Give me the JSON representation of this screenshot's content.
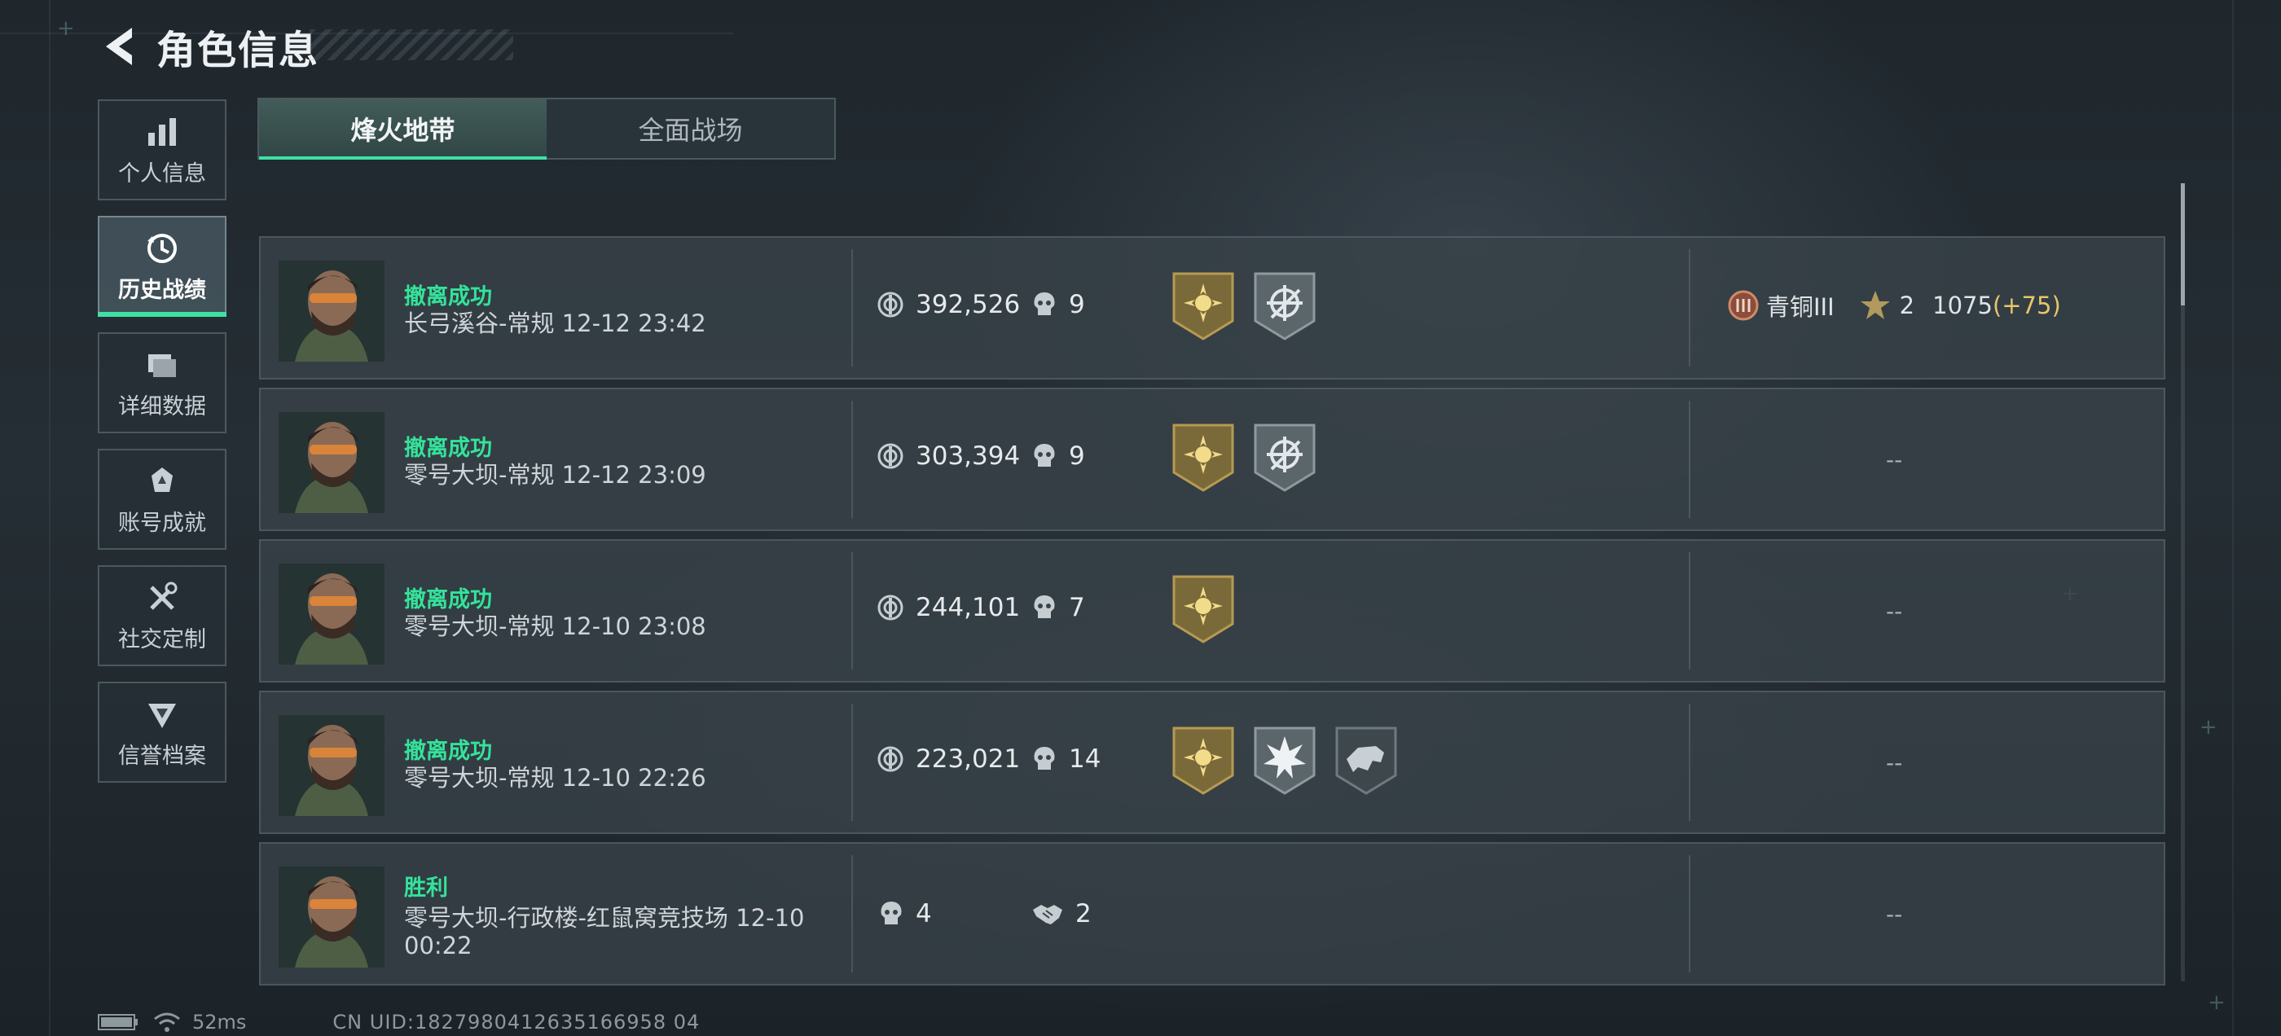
{
  "header": {
    "title": "角色信息",
    "back_icon": "chevron-left-icon"
  },
  "sidenav": {
    "items": [
      {
        "label": "个人信息",
        "icon": "bar-chart-icon",
        "active": false
      },
      {
        "label": "历史战绩",
        "icon": "history-clock-icon",
        "active": true
      },
      {
        "label": "详细数据",
        "icon": "folders-icon",
        "active": false
      },
      {
        "label": "账号成就",
        "icon": "achievement-icon",
        "active": false
      },
      {
        "label": "社交定制",
        "icon": "tools-icon",
        "active": false
      },
      {
        "label": "信誉档案",
        "icon": "reputation-shield-icon",
        "active": false
      }
    ]
  },
  "tabs": [
    {
      "label": "烽火地带",
      "active": true
    },
    {
      "label": "全面战场",
      "active": false
    }
  ],
  "matches": [
    {
      "result": "撤离成功",
      "map": "长弓溪谷-常规 12-12 23:42",
      "value": "392,526",
      "kills": "9",
      "badges": [
        "gold-sun-badge",
        "silver-crosshair-badge"
      ],
      "rank": {
        "name": "青铜III",
        "stars": "2",
        "score": "1075",
        "gain": "(+75)"
      }
    },
    {
      "result": "撤离成功",
      "map": "零号大坝-常规 12-12 23:09",
      "value": "303,394",
      "kills": "9",
      "badges": [
        "gold-sun-badge",
        "silver-crosshair-badge"
      ],
      "right": "--"
    },
    {
      "result": "撤离成功",
      "map": "零号大坝-常规 12-10 23:08",
      "value": "244,101",
      "kills": "7",
      "badges": [
        "gold-sun-badge"
      ],
      "right": "--"
    },
    {
      "result": "撤离成功",
      "map": "零号大坝-常规 12-10 22:26",
      "value": "223,021",
      "kills": "14",
      "badges": [
        "gold-sun-badge",
        "silver-burst-badge",
        "dark-bull-badge"
      ],
      "right": "--"
    },
    {
      "result": "胜利",
      "map": "零号大坝-行政楼-红鼠窝竞技场 12-10 00:22",
      "kills": "4",
      "assists": "2",
      "right": "--"
    }
  ],
  "footer": {
    "ping": "52ms",
    "uid": "CN UID:1827980412635166958 04"
  },
  "colors": {
    "accent": "#3fe0a6",
    "gold": "#e7c66a",
    "success_text": "#34e39b"
  }
}
